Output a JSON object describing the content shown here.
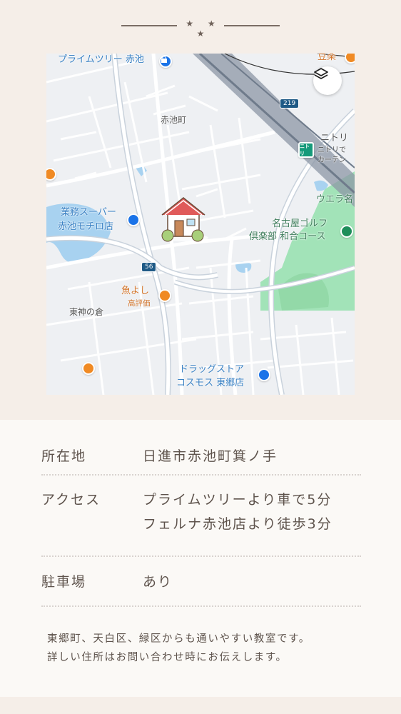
{
  "divider": {
    "stars": "★ ★ ★"
  },
  "map": {
    "labels": {
      "prime_tree": "プライムツリー 赤池",
      "tofu": "豆楽",
      "akaike_cho": "赤池町",
      "nitori": "ニトリ",
      "nitori_sub1": "ニトリで",
      "nitori_sub2": "カーテン",
      "uetera": "ウエラ名",
      "gyomu1": "業務スーパー",
      "gyomu2": "赤池モチロ店",
      "golf1": "名古屋ゴルフ",
      "golf2": "倶楽部 和合コース",
      "uoyoshi": "魚よし",
      "rating": "高評価",
      "higashi_kaminokura": "東神の倉",
      "drug1": "ドラッグストア",
      "drug2": "コスモス 東郷店"
    },
    "route_219": "219",
    "route_56": "56",
    "nitori_logo": "ニトリ",
    "icons": [
      "layers-icon",
      "house-icon",
      "shopping-bag-icon",
      "cart-icon",
      "restaurant-icon",
      "cafe-icon",
      "golf-icon"
    ]
  },
  "info": {
    "rows": [
      {
        "key": "所在地",
        "value_lines": [
          "日進市赤池町箕ノ手"
        ]
      },
      {
        "key": "アクセス",
        "value_lines": [
          "プライムツリーより車で5分",
          "フェルナ赤池店より徒歩3分"
        ]
      },
      {
        "key": "駐車場",
        "value_lines": [
          "あり"
        ]
      }
    ],
    "note_lines": [
      "東郷町、天白区、緑区からも通いやすい教室です。",
      "詳しい住所はお問い合わせ時にお伝えします。"
    ]
  },
  "colors": {
    "background": "#f5eee8",
    "panel": "#fbf9f6",
    "text": "#5e534c",
    "map_water": "#a8d2f0",
    "map_park": "#9fe0b4",
    "house_roof": "#e05a5a"
  }
}
